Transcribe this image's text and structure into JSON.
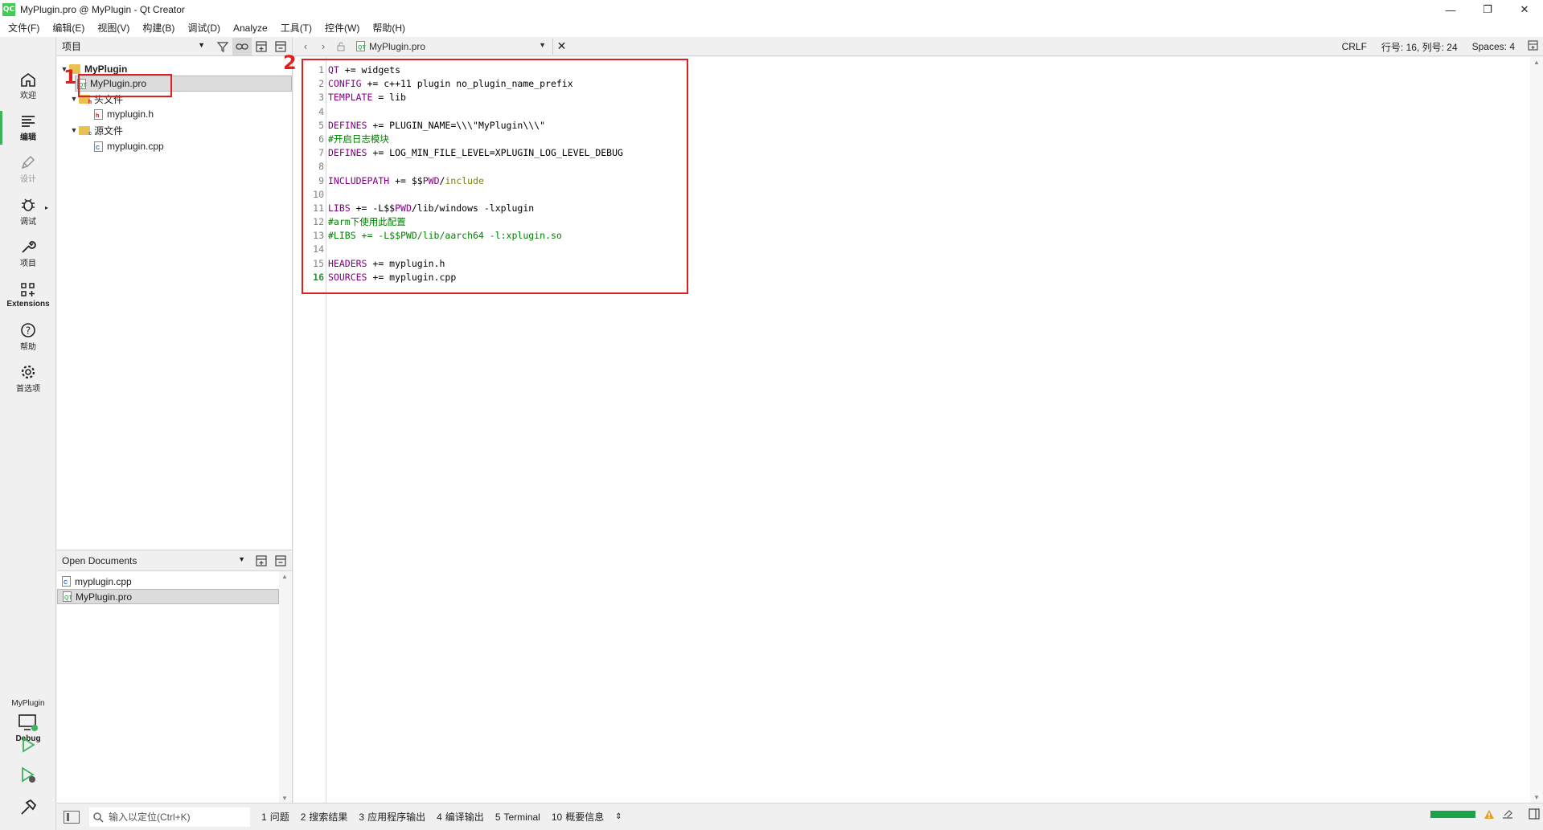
{
  "window": {
    "title": "MyPlugin.pro @ MyPlugin - Qt Creator",
    "logo_text": "QC",
    "controls": {
      "minimize": "—",
      "restore": "❐",
      "close": "✕"
    }
  },
  "menubar": [
    "文件(F)",
    "编辑(E)",
    "视图(V)",
    "构建(B)",
    "调试(D)",
    "Analyze",
    "工具(T)",
    "控件(W)",
    "帮助(H)"
  ],
  "modes": {
    "welcome": "欢迎",
    "edit": "编辑",
    "design": "设计",
    "debug": "调试",
    "projects": "项目",
    "extensions": "Extensions",
    "help": "帮助",
    "preferences": "首选项"
  },
  "kit": {
    "project": "MyPlugin",
    "build": "Debug"
  },
  "project_panel": {
    "view_select": "项目",
    "tree": {
      "root": "MyPlugin",
      "pro_file": "MyPlugin.pro",
      "headers_folder": "头文件",
      "header_file": "myplugin.h",
      "sources_folder": "源文件",
      "source_file": "myplugin.cpp"
    }
  },
  "open_documents": {
    "title": "Open Documents",
    "items": [
      "myplugin.cpp",
      "MyPlugin.pro"
    ]
  },
  "editor": {
    "current_document": "MyPlugin.pro",
    "line_ending": "CRLF",
    "position": "行号: 16, 列号: 24",
    "indent": "Spaces: 4",
    "current_line": 16,
    "lines": [
      "QT += widgets",
      "CONFIG += c++11 plugin no_plugin_name_prefix",
      "TEMPLATE = lib",
      "",
      "DEFINES += PLUGIN_NAME=\\\\\\\"MyPlugin\\\\\\\"",
      "#开启日志模块",
      "DEFINES += LOG_MIN_FILE_LEVEL=XPLUGIN_LOG_LEVEL_DEBUG",
      "",
      "INCLUDEPATH += $$PWD/include",
      "",
      "LIBS += -L$$PWD/lib/windows -lxplugin",
      "#arm下使用此配置",
      "#LIBS += -L$$PWD/lib/aarch64 -l:xplugin.so",
      "",
      "HEADERS += myplugin.h",
      "SOURCES += myplugin.cpp"
    ]
  },
  "annotations": {
    "one": "1",
    "two": "2"
  },
  "bottombar": {
    "locator_placeholder": "输入以定位(Ctrl+K)",
    "tabs": [
      {
        "num": "1",
        "label": "问题"
      },
      {
        "num": "2",
        "label": "搜索结果"
      },
      {
        "num": "3",
        "label": "应用程序输出"
      },
      {
        "num": "4",
        "label": "编译输出"
      },
      {
        "num": "5",
        "label": "Terminal"
      },
      {
        "num": "10",
        "label": "概要信息"
      }
    ]
  },
  "colors": {
    "accent": "#3eb25a",
    "annotation": "#e02020",
    "keyword": "#800080",
    "comment": "#008000"
  }
}
